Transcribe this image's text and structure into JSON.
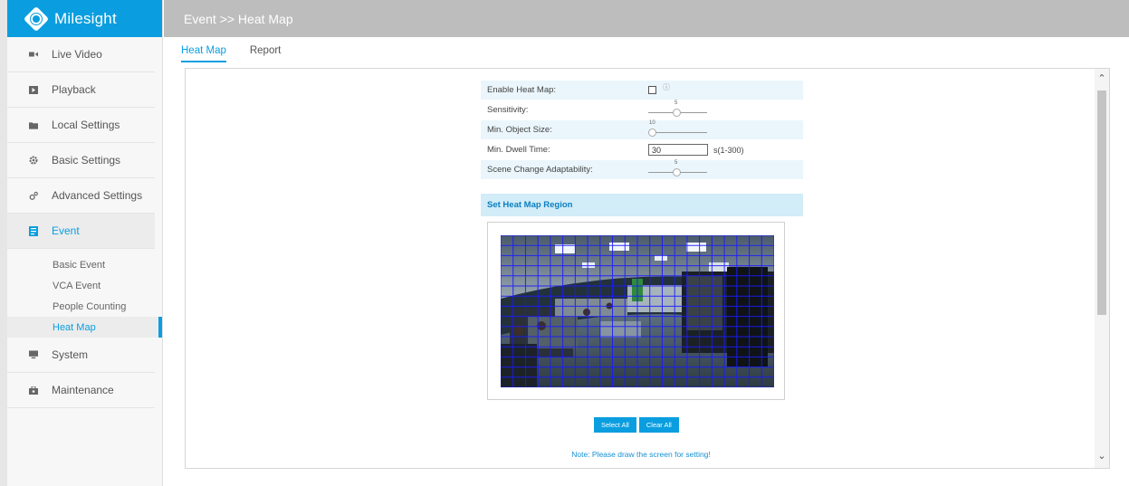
{
  "brand": {
    "name": "Milesight"
  },
  "header": {
    "breadcrumb": "Event >> Heat Map"
  },
  "sidebar": {
    "items": [
      {
        "label": "Live Video",
        "icon": "video-icon"
      },
      {
        "label": "Playback",
        "icon": "playback-icon"
      },
      {
        "label": "Local Settings",
        "icon": "folder-icon"
      },
      {
        "label": "Basic Settings",
        "icon": "gear-icon"
      },
      {
        "label": "Advanced Settings",
        "icon": "gears-icon"
      },
      {
        "label": "Event",
        "icon": "event-icon"
      },
      {
        "label": "System",
        "icon": "monitor-icon"
      },
      {
        "label": "Maintenance",
        "icon": "toolbox-icon"
      }
    ],
    "event_sub": [
      "Basic Event",
      "VCA Event",
      "People Counting",
      "Heat Map"
    ],
    "selected_sub": "Heat Map"
  },
  "tabs": [
    {
      "label": "Heat Map",
      "active": true
    },
    {
      "label": "Report",
      "active": false
    }
  ],
  "form": {
    "enable_label": "Enable Heat Map:",
    "enable_checked": false,
    "sensitivity_label": "Sensitivity:",
    "sensitivity_value": "5",
    "min_object_label": "Min. Object Size:",
    "min_object_value": "10",
    "dwell_label": "Min. Dwell Time:",
    "dwell_value": "30",
    "dwell_range": "s(1-300)",
    "scene_label": "Scene Change Adaptability:",
    "scene_value": "5"
  },
  "region": {
    "title": "Set Heat Map Region"
  },
  "buttons": {
    "select_all": "Select All",
    "clear_all": "Clear All"
  },
  "note": "Note: Please draw the screen for setting!",
  "colors": {
    "accent": "#0a9ee0",
    "header_bg": "#bdbdbd",
    "grid": "#1a1aff",
    "row_shade": "#eaf6fc"
  }
}
